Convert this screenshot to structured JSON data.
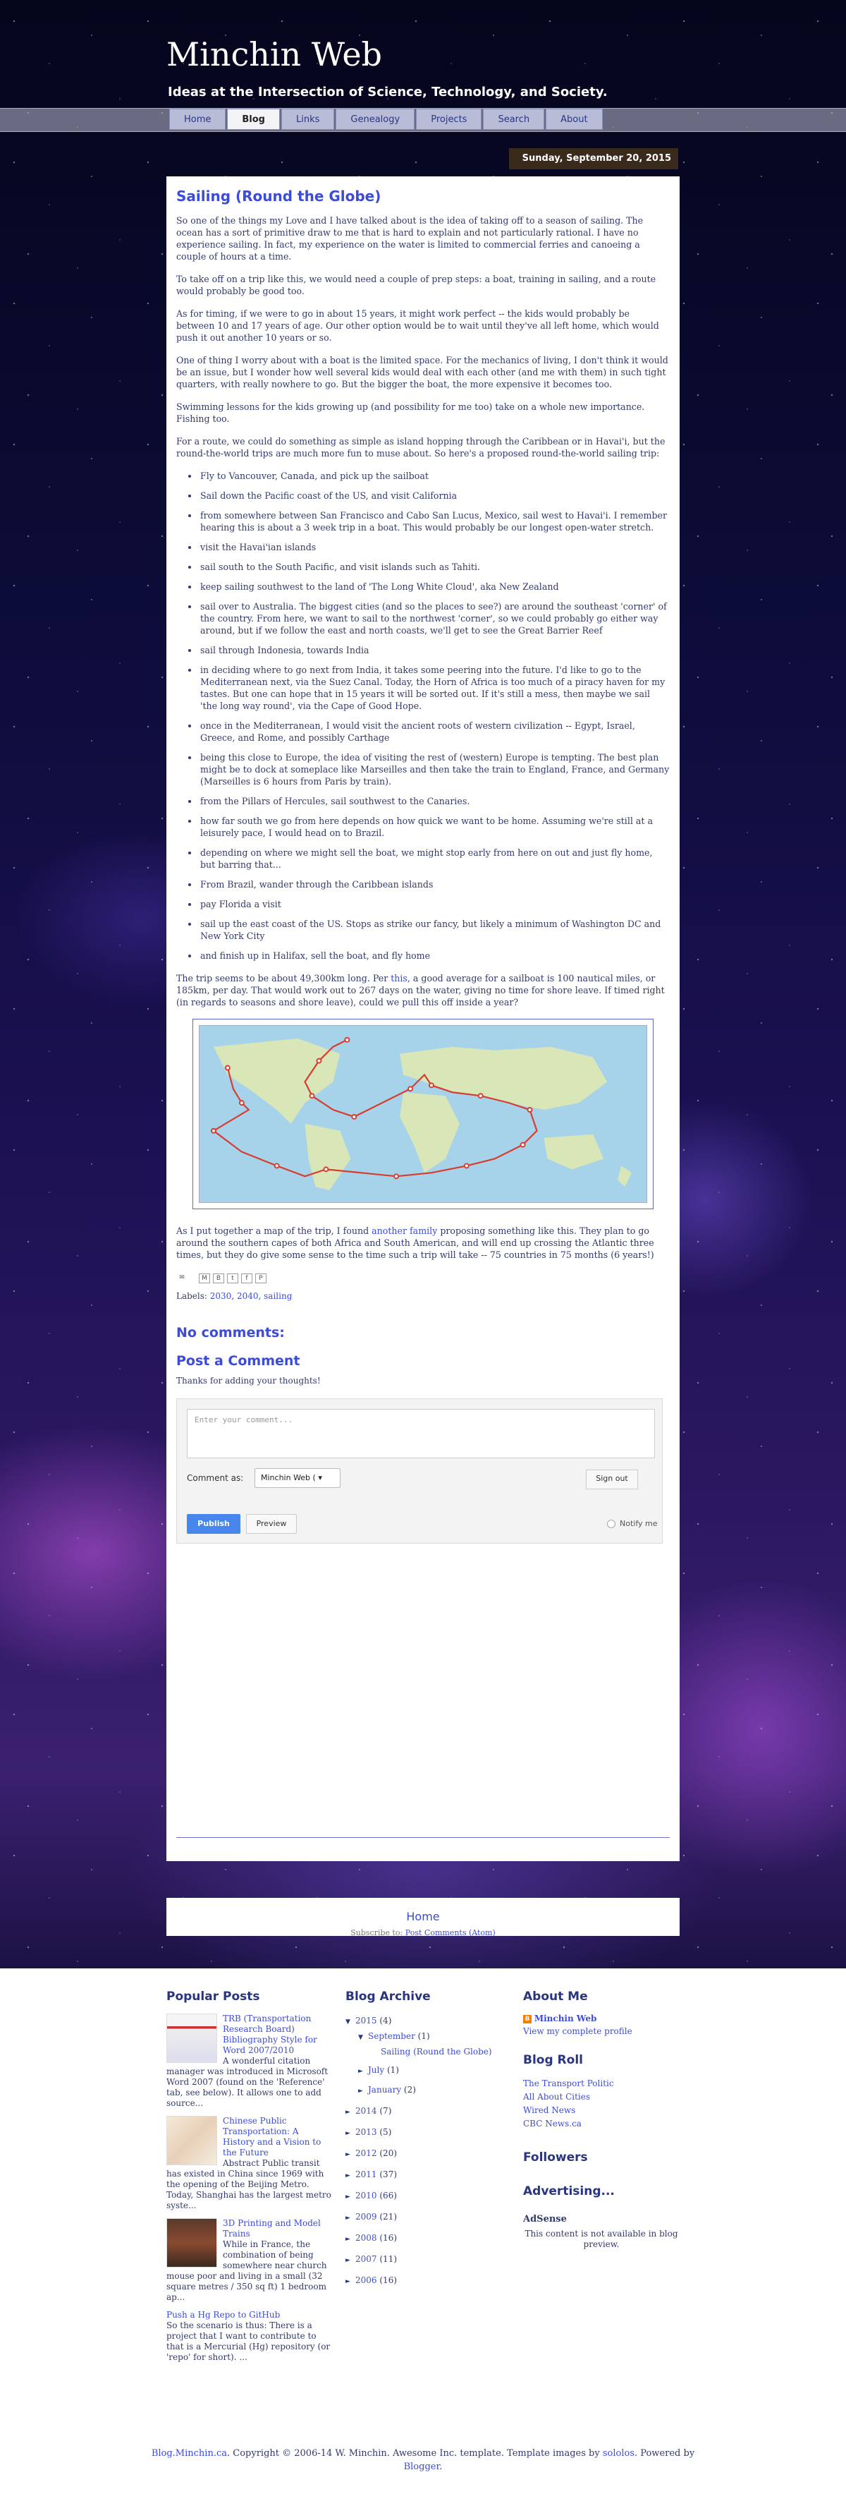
{
  "blog": {
    "title": "Minchin Web",
    "description": "Ideas at the Intersection of Science, Technology, and Society."
  },
  "tabs": [
    {
      "label": "Home"
    },
    {
      "label": "Blog",
      "active": true
    },
    {
      "label": "Links"
    },
    {
      "label": "Genealogy"
    },
    {
      "label": "Projects"
    },
    {
      "label": "Search"
    },
    {
      "label": "About"
    }
  ],
  "post": {
    "date": "Sunday, September 20, 2015",
    "title": "Sailing (Round the Globe)",
    "paragraphs_before": [
      "So one of the things my Love and I have talked about is the idea of taking off to a season of sailing. The ocean has a sort of primitive draw to me that is hard to explain and not particularly rational. I have no experience sailing. In fact, my experience on the water is limited to commercial ferries and canoeing a couple of hours at a time.",
      "To take off on a trip like this, we would need a couple of prep steps: a boat, training in sailing, and a route would probably be good too.",
      "As for timing, if we were to go in about 15 years, it might work perfect -- the kids would probably be between 10 and 17 years of age. Our other option would be to wait until they've all left home, which would push it out another 10 years or so.",
      "One of thing I worry about with a boat is the limited space. For the mechanics of living, I don't think it would be an issue, but I wonder how well several kids would deal with each other (and me with them) in such tight quarters, with really nowhere to go. But the bigger the boat, the more expensive it becomes too.",
      "Swimming lessons for the kids growing up (and possibility for me too) take on a whole new importance. Fishing too.",
      "For a route, we could do something as simple as island hopping through the Caribbean or in Havai'i, but the round-the-world trips are much more fun to muse about. So here's a proposed round-the-world sailing trip:"
    ],
    "route": [
      "Fly to Vancouver, Canada, and pick up the sailboat",
      "Sail down the Pacific coast of the US, and visit California",
      "from somewhere between San Francisco and Cabo San Lucus, Mexico, sail west to Havai'i. I remember hearing this is about a 3 week trip in a boat. This would probably be our longest open-water stretch.",
      "visit the Havai'ian islands",
      "sail south to the South Pacific, and visit islands such as Tahiti.",
      "keep sailing southwest to the land of 'The Long White Cloud', aka New Zealand",
      "sail over to Australia. The biggest cities (and so the places to see?) are around the southeast 'corner' of the country. From here, we want to sail to the northwest 'corner', so we could probably go either way around, but if we follow the east and north coasts, we'll get to see the Great Barrier Reef",
      "sail through Indonesia, towards India",
      "in deciding where to go next from India, it takes some peering into the future. I'd like to go to the Mediterranean next, via the Suez Canal. Today, the Horn of Africa is too much of a piracy haven for my tastes. But one can hope that in 15 years it will be sorted out. If it's still a mess, then maybe we sail 'the long way round', via the Cape of Good Hope.",
      "once in the Mediterranean, I would visit the ancient roots of western civilization -- Egypt, Israel, Greece, and Rome, and possibly Carthage",
      "being this close to Europe, the idea of visiting the rest of (western) Europe is tempting. The best plan might be to dock at someplace like Marseilles and then take the train to England, France, and Germany (Marseilles is 6 hours from Paris by train).",
      "from the Pillars of Hercules, sail southwest to the Canaries.",
      "how far south we go from here depends on how quick we want to be home. Assuming we're still at a leisurely pace, I would head on to Brazil.",
      "depending on where we might sell the boat, we might stop early from here on out and just fly home, but barring that...",
      "From Brazil, wander through the Caribbean islands",
      "pay Florida a visit",
      "sail up the east coast of the US. Stops as strike our fancy, but likely a minimum of Washington DC and New York City",
      "and finish up in Halifax, sell the boat, and fly home"
    ],
    "trip_para_a": "The trip seems to be about 49,300km long. Per ",
    "trip_link": "this",
    "trip_para_b": ", a good average for a sailboat is 100 nautical miles, or 185km, per day. That would work out to 267 days on the water, giving no time for shore leave. If timed right (in regards to seasons and shore leave), could we pull this off inside a year?",
    "after_para_a": "As I put together a map of the trip, I found ",
    "after_link": "another family",
    "after_para_b": " proposing something like this. They plan to go around the southern capes of both Africa and South American, and will end up crossing the Atlantic three times, but they do give some sense to the time such a trip will take -- 75 countries in 75 months (6 years!)",
    "labels_prefix": "Labels: ",
    "labels": [
      "2030",
      "2040",
      "sailing"
    ]
  },
  "comments": {
    "no_comments": "No comments:",
    "post_a_comment": "Post a Comment",
    "thanks": "Thanks for adding your thoughts!",
    "placeholder": "Enter your comment...",
    "comment_as": "Comment as:",
    "identity": "Minchin Web (",
    "sign_out": "Sign out",
    "publish": "Publish",
    "preview": "Preview",
    "notify": "Notify me"
  },
  "nav": {
    "home": "Home",
    "subscribe_prefix": "Subscribe to: ",
    "subscribe_link": "Post Comments (Atom)"
  },
  "popular_posts": {
    "heading": "Popular Posts",
    "items": [
      {
        "title": "TRB (Transportation Research Board) Bibliography Style for Word 2007/2010",
        "snippet": "A wonderful citation manager was introduced in Microsoft Word 2007 (found on the 'Reference' tab, see below). It allows one to add source..."
      },
      {
        "title": "Chinese Public Transportation: A History and a Vision to the Future",
        "snippet": "Abstract Public transit has existed in China since 1969 with the opening of the Beijing Metro. Today, Shanghai has the largest metro syste..."
      },
      {
        "title": "3D Printing and Model Trains",
        "snippet": "While in France, the combination of being somewhere near church mouse poor and living in a small (32 square metres / 350 sq ft) 1 bedroom ap..."
      },
      {
        "title": "Push a Hg Repo to GitHub",
        "snippet": "So the scenario is thus: There is a project that I want to contribute to that is a Mercurial (Hg) repository (or 'repo' for short). ..."
      }
    ]
  },
  "archive": {
    "heading": "Blog Archive",
    "year_2015": "2015",
    "count_2015": "(4)",
    "september": "September",
    "count_september": "(1)",
    "sailing_post": "Sailing (Round the Globe)",
    "july": "July",
    "count_july": "(1)",
    "january": "January",
    "count_january": "(2)",
    "years": [
      {
        "year": "2014",
        "count": "(7)"
      },
      {
        "year": "2013",
        "count": "(5)"
      },
      {
        "year": "2012",
        "count": "(20)"
      },
      {
        "year": "2011",
        "count": "(37)"
      },
      {
        "year": "2010",
        "count": "(66)"
      },
      {
        "year": "2009",
        "count": "(21)"
      },
      {
        "year": "2008",
        "count": "(16)"
      },
      {
        "year": "2007",
        "count": "(11)"
      },
      {
        "year": "2006",
        "count": "(16)"
      }
    ]
  },
  "about": {
    "heading": "About Me",
    "name": "Minchin Web",
    "profile": "View my complete profile",
    "blogroll_heading": "Blog Roll",
    "blogroll": [
      "The Transport Politic",
      "All About Cities",
      "Wired News",
      "CBC News.ca"
    ],
    "followers": "Followers",
    "advertising": "Advertising...",
    "adsense": "AdSense",
    "adsense_note": "This content is not available in blog preview."
  },
  "credit": {
    "site": "Blog.Minchin.ca",
    "text_a": ". Copyright © 2006-14 W. Minchin. Awesome Inc. template. Template images by ",
    "author": "sololos",
    "text_b": ". Powered by ",
    "blogger": "Blogger",
    "end": "."
  },
  "colors": {
    "link": "#3c4bd8",
    "heading": "#2a3580",
    "text": "#333a6a",
    "date_bg": "#3a2a1c",
    "publish_bg": "#4787ed"
  }
}
